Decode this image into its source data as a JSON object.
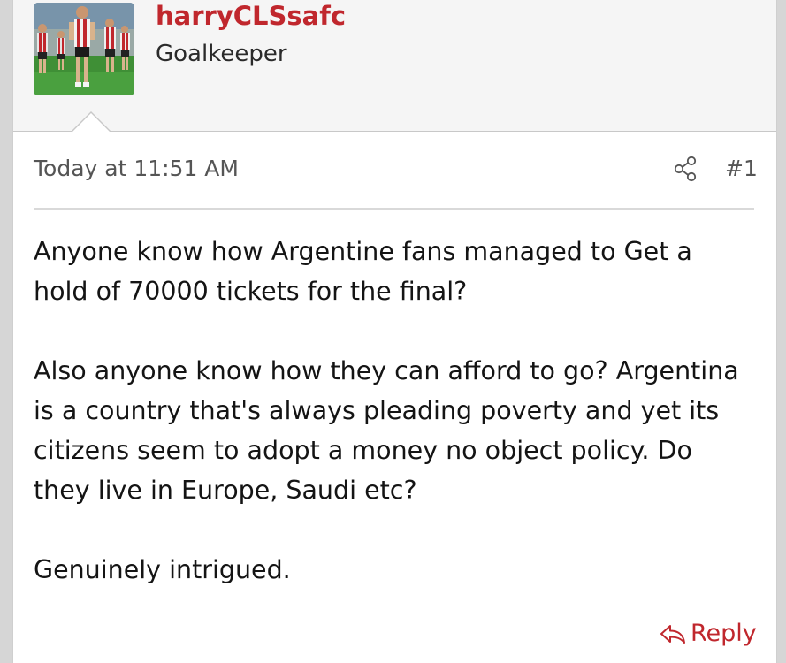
{
  "user": {
    "username": "harryCLSsafc",
    "title": "Goalkeeper",
    "avatar_icon": "user-avatar-football-photo"
  },
  "post": {
    "timestamp": "Today at 11:51 AM",
    "number": "#1",
    "paragraphs": [
      "Anyone know how Argentine fans managed to Get a hold of 70000 tickets for the final?",
      "Also anyone know how they can afford to go? Argentina is a country that's always pleading poverty and yet its citizens seem to adopt a money no object policy. Do they live in Europe, Saudi etc?",
      "Genuinely intrigued."
    ]
  },
  "actions": {
    "share_icon": "share-icon",
    "reply_label": "Reply",
    "reply_icon": "reply-arrow-icon"
  },
  "colors": {
    "accent": "#c0272d",
    "text": "#141414",
    "meta": "#555555",
    "background": "#ffffff",
    "header_background": "#f5f5f5"
  }
}
